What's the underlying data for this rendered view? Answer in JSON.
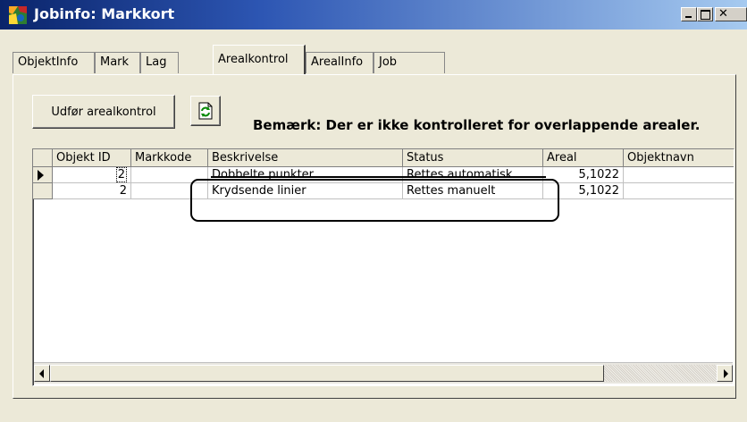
{
  "window": {
    "title": "Jobinfo: Markkort",
    "controls": {
      "minimize": "minimize-icon",
      "maximize": "maximize-icon",
      "close": "close-icon"
    }
  },
  "tabs": [
    "ObjektInfo",
    "Mark",
    "Lag",
    "Arealkontrol",
    "ArealInfo",
    "Job"
  ],
  "active_tab": "Arealkontrol",
  "toolbar": {
    "run_button": "Udfør arealkontrol",
    "refresh_icon": "refresh-icon",
    "note": "Bemærk: Der er ikke kontrolleret for overlappende arealer."
  },
  "grid": {
    "columns": [
      "Objekt ID",
      "Markkode",
      "Beskrivelse",
      "Status",
      "Areal",
      "Objektnavn"
    ],
    "rows": [
      {
        "objekt_id": "2",
        "markkode": "",
        "beskrivelse": "Dobbelte punkter",
        "status": "Rettes automatisk",
        "areal": "5,1022",
        "objektnavn": ""
      },
      {
        "objekt_id": "2",
        "markkode": "",
        "beskrivelse": "Krydsende linier",
        "status": "Rettes manuelt",
        "areal": "5,1022",
        "objektnavn": ""
      }
    ],
    "current_row_icon": "row-pointer-icon"
  },
  "colors": {
    "titlebar_start": "#0a246a",
    "titlebar_end": "#a6caf0",
    "face": "#ece9d8"
  }
}
